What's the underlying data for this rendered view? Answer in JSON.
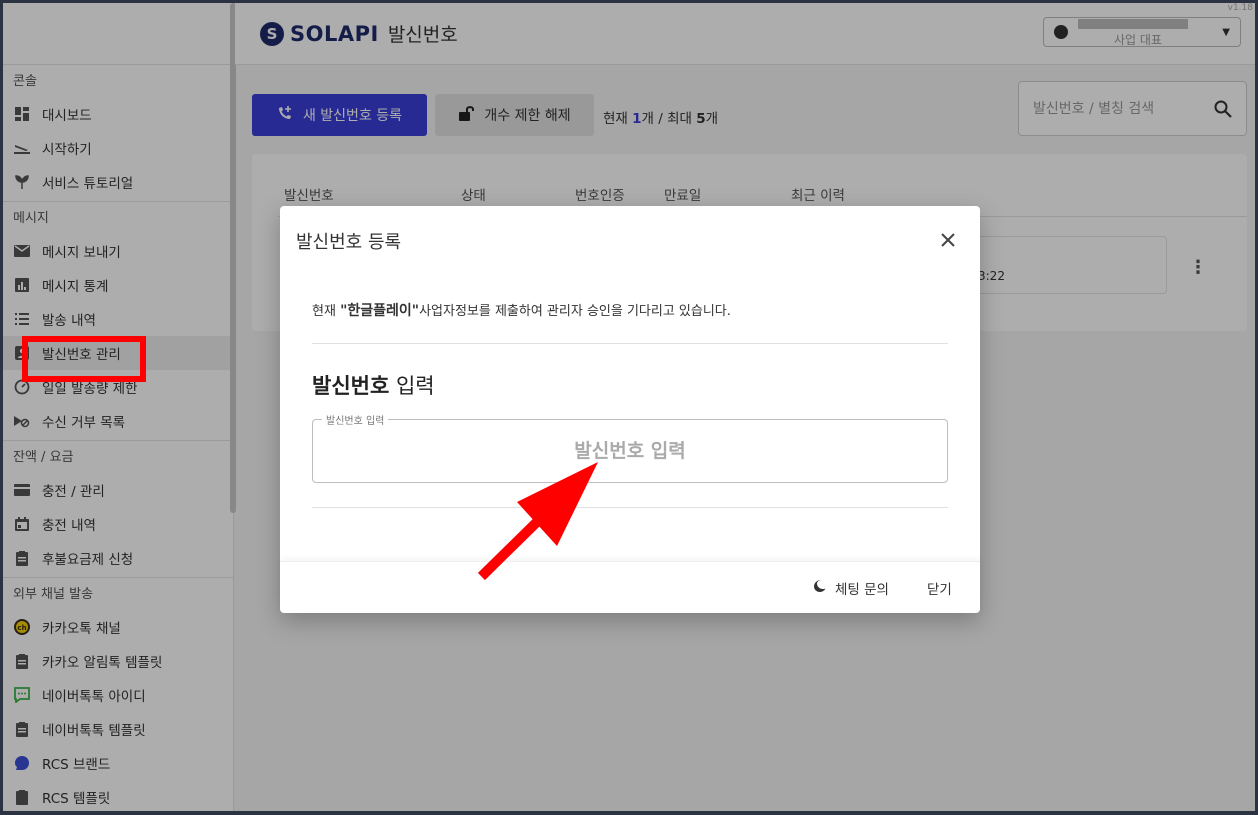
{
  "header": {
    "logo_mark": "S",
    "logo_text": "SOLAPI",
    "page_title": "발신번호",
    "account_name": "   사업 대표",
    "version": "v1.18"
  },
  "sidebar": {
    "sections": [
      {
        "title": "콘솔",
        "items": [
          {
            "label": "대시보드",
            "icon": "dashboard-icon"
          },
          {
            "label": "시작하기",
            "icon": "plane-icon"
          },
          {
            "label": "서비스 튜토리얼",
            "icon": "sprout-icon"
          }
        ]
      },
      {
        "title": "메시지",
        "items": [
          {
            "label": "메시지 보내기",
            "icon": "mail-icon"
          },
          {
            "label": "메시지 통계",
            "icon": "chart-icon"
          },
          {
            "label": "발송 내역",
            "icon": "list-icon"
          },
          {
            "label": "발신번호 관리",
            "icon": "contact-icon"
          },
          {
            "label": "일일 발송량 제한",
            "icon": "gauge-icon"
          },
          {
            "label": "수신 거부 목록",
            "icon": "block-icon"
          }
        ]
      },
      {
        "title": "잔액 / 요금",
        "items": [
          {
            "label": "충전 / 관리",
            "icon": "card-icon"
          },
          {
            "label": "충전 내역",
            "icon": "calendar-icon"
          },
          {
            "label": "후불요금제 신청",
            "icon": "clipboard-icon"
          }
        ]
      },
      {
        "title": "외부 채널 발송",
        "items": [
          {
            "label": "카카오톡 채널",
            "icon": "kakao-icon"
          },
          {
            "label": "카카오 알림톡 템플릿",
            "icon": "clipboard-icon"
          },
          {
            "label": "네이버톡톡 아이디",
            "icon": "talk-icon"
          },
          {
            "label": "네이버톡톡 템플릿",
            "icon": "clipboard-icon"
          },
          {
            "label": "RCS 브랜드",
            "icon": "rcs-icon"
          },
          {
            "label": "RCS 템플릿",
            "icon": "clipboard-icon"
          }
        ]
      }
    ]
  },
  "toolbar": {
    "register_label": "새 발신번호 등록",
    "unlock_label": "개수 제한 해제",
    "count_prefix": "현재 ",
    "count_current": "1",
    "count_mid": "개 / 최대 ",
    "count_max": "5",
    "count_suffix": "개",
    "search_placeholder": "발신번호 / 별칭 검색"
  },
  "table": {
    "headers": [
      "발신번호",
      "상태",
      "번호인증",
      "만료일",
      "최근 이력"
    ],
    "row_time": "3:22"
  },
  "modal": {
    "title": "발신번호 등록",
    "notice_prefix": "현재 ",
    "notice_company": "\"한글플레이\"",
    "notice_suffix": "사업자정보를 제출하여 관리자 승인을 기다리고 있습니다.",
    "section_bold": "발신번호",
    "section_rest": " 입력",
    "field_legend": "발신번호 입력",
    "field_placeholder": "발신번호 입력",
    "chat_label": "체팅 문의",
    "close_label": "닫기"
  },
  "colors": {
    "primary": "#3c3fd9",
    "annotation": "#ff0000",
    "brand": "#1e2a6b"
  }
}
